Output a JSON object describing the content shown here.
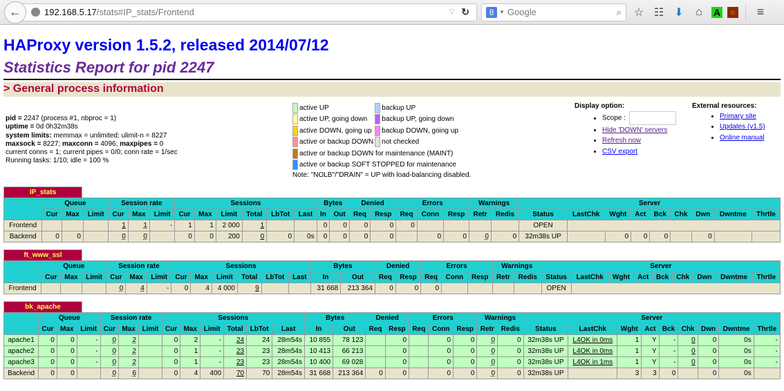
{
  "browser": {
    "url_host": "192.168.5.17",
    "url_path": "/stats#IP_stats/Frontend",
    "search_placeholder": "Google",
    "icons": [
      "back-arrow-icon",
      "globe-icon",
      "dropdown-icon",
      "reload-icon",
      "google-icon",
      "search-icon",
      "bookmark-star-icon",
      "reading-list-icon",
      "download-icon",
      "home-icon",
      "addon-a-icon",
      "addon-ext-icon",
      "menu-icon"
    ]
  },
  "header": {
    "title": "HAProxy version 1.5.2, released 2014/07/12",
    "subtitle": "Statistics Report for pid 2247",
    "section": "> General process information"
  },
  "process": {
    "pid_label": "pid =",
    "pid_value": " 2247 (process #1, nbproc = 1)",
    "uptime_label": "uptime =",
    "uptime_value": " 0d 0h32m38s",
    "limits_label": "system limits:",
    "limits_value": " memmax = unlimited; ulimit-n = 8227",
    "maxsock_label": "maxsock =",
    "maxsock_value": " 8227; ",
    "maxconn_label": "maxconn =",
    "maxconn_value": " 4096; ",
    "maxpipes_label": "maxpipes =",
    "maxpipes_value": " 0",
    "conns": "current conns = 1; current pipes = 0/0; conn rate = 1/sec",
    "tasks": "Running tasks: 1/10; idle = 100 %"
  },
  "legend": {
    "items": [
      {
        "label": "active UP",
        "color": "#c0ffc0"
      },
      {
        "label": "backup UP",
        "color": "#b0d0ff"
      },
      {
        "label": "active UP, going down",
        "color": "#ffffa0"
      },
      {
        "label": "backup UP, going down",
        "color": "#c060ff"
      },
      {
        "label": "active DOWN, going up",
        "color": "#ffd020"
      },
      {
        "label": "backup DOWN, going up",
        "color": "#ff80ff"
      },
      {
        "label": "active or backup DOWN",
        "color": "#ff9090"
      },
      {
        "label": "not checked",
        "color": "#e0e0e0"
      },
      {
        "label": "active or backup DOWN for maintenance (MAINT)",
        "color": "#c07820"
      },
      {
        "label": "active or backup SOFT STOPPED for maintenance",
        "color": "#3090ff"
      }
    ],
    "note": "Note: \"NOLB\"/\"DRAIN\" = UP with load-balancing disabled."
  },
  "display_options": {
    "title": "Display option:",
    "scope_label": "Scope :",
    "scope_value": "",
    "hide_down": "Hide 'DOWN' servers",
    "refresh": "Refresh now",
    "csv": "CSV export"
  },
  "external": {
    "title": "External resources:",
    "primary": "Primary site",
    "updates": "Updates (v1.5)",
    "manual": "Online manual"
  },
  "headers": {
    "groups": [
      "Queue",
      "Session rate",
      "Sessions",
      "Bytes",
      "Denied",
      "Errors",
      "Warnings",
      "Server"
    ],
    "queue": [
      "Cur",
      "Max",
      "Limit"
    ],
    "rate": [
      "Cur",
      "Max",
      "Limit"
    ],
    "sessions": [
      "Cur",
      "Max",
      "Limit",
      "Total",
      "LbTot",
      "Last"
    ],
    "bytes": [
      "In",
      "Out"
    ],
    "denied": [
      "Req",
      "Resp"
    ],
    "errors": [
      "Req",
      "Conn",
      "Resp"
    ],
    "warnings": [
      "Retr",
      "Redis"
    ],
    "server": [
      "Status",
      "LastChk",
      "Wght",
      "Act",
      "Bck",
      "Chk",
      "Dwn",
      "Dwntme",
      "Thrtle"
    ]
  },
  "proxies": [
    {
      "name": "IP_stats",
      "rows": [
        {
          "type": "fe",
          "cells": [
            "Frontend",
            "",
            "",
            "",
            "1",
            "1",
            "-",
            "1",
            "1",
            "2 000",
            "1",
            "",
            "",
            "0",
            "0",
            "0",
            "0",
            "0",
            "",
            "",
            "",
            "",
            "OPEN"
          ]
        },
        {
          "type": "be",
          "cells": [
            "Backend",
            "0",
            "0",
            "",
            "0",
            "0",
            "",
            "0",
            "0",
            "200",
            "0",
            "0",
            "0s",
            "0",
            "0",
            "0",
            "0",
            "",
            "0",
            "0",
            "0",
            "0",
            "32m38s UP",
            "",
            "0",
            "0",
            "0",
            "",
            "0",
            "",
            ""
          ]
        }
      ]
    },
    {
      "name": "ft_www_ssl",
      "rows": [
        {
          "type": "fe",
          "cells": [
            "Frontend",
            "",
            "",
            "",
            "0",
            "4",
            "-",
            "0",
            "4",
            "4 000",
            "9",
            "",
            "",
            "31 668",
            "213 364",
            "0",
            "0",
            "0",
            "",
            "",
            "",
            "",
            "OPEN"
          ]
        }
      ]
    },
    {
      "name": "bk_apache",
      "rows": [
        {
          "type": "up",
          "cells": [
            "apache1",
            "0",
            "0",
            "-",
            "0",
            "2",
            "",
            "0",
            "2",
            "-",
            "24",
            "24",
            "28m54s",
            "10 855",
            "78 123",
            "",
            "0",
            "",
            "0",
            "0",
            "0",
            "0",
            "32m38s UP",
            "L4OK in 0ms",
            "1",
            "Y",
            "-",
            "0",
            "0",
            "0s",
            "-"
          ]
        },
        {
          "type": "up",
          "cells": [
            "apache2",
            "0",
            "0",
            "-",
            "0",
            "2",
            "",
            "0",
            "1",
            "-",
            "23",
            "23",
            "28m54s",
            "10 413",
            "66 213",
            "",
            "0",
            "",
            "0",
            "0",
            "0",
            "0",
            "32m38s UP",
            "L4OK in 0ms",
            "1",
            "Y",
            "-",
            "0",
            "0",
            "0s",
            "-"
          ]
        },
        {
          "type": "up",
          "cells": [
            "apache3",
            "0",
            "0",
            "-",
            "0",
            "2",
            "",
            "0",
            "1",
            "-",
            "23",
            "23",
            "28m54s",
            "10 400",
            "69 028",
            "",
            "0",
            "",
            "0",
            "0",
            "0",
            "0",
            "32m38s UP",
            "L4OK in 1ms",
            "1",
            "Y",
            "-",
            "0",
            "0",
            "0s",
            "-"
          ]
        },
        {
          "type": "be",
          "cells": [
            "Backend",
            "0",
            "0",
            "",
            "0",
            "6",
            "",
            "0",
            "4",
            "400",
            "70",
            "70",
            "28m54s",
            "31 668",
            "213 364",
            "0",
            "0",
            "",
            "0",
            "0",
            "0",
            "0",
            "32m38s UP",
            "",
            "3",
            "3",
            "0",
            "",
            "0",
            "0s",
            ""
          ]
        }
      ]
    }
  ]
}
